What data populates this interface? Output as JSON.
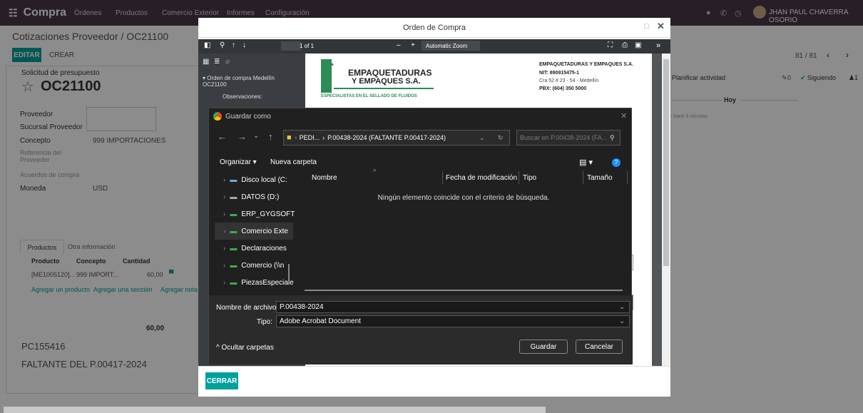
{
  "app": {
    "brand": "Compra",
    "menu": [
      "Órdenes",
      "Productos",
      "Comercio Exterior",
      "Informes",
      "Configuración"
    ],
    "user": "JHAN PAUL CHAVERRA OSORIO"
  },
  "page": {
    "breadcrumb": "Cotizaciones Proveedor / OC21100",
    "edit_label": "EDITAR",
    "create_label": "CREAR",
    "pager": "81 / 81",
    "doc_type": "Solicitud de presupuesto",
    "doc_number": "OC21100",
    "fields": [
      {
        "label": "Proveedor",
        "value": ""
      },
      {
        "label": "Sucursal Proveedor",
        "value": ""
      },
      {
        "label": "Concepto",
        "value": "999 IMPORTACIONES"
      },
      {
        "label": "Referencia del Proveedor",
        "value": ""
      },
      {
        "label": "Acuerdos de compra",
        "value": ""
      },
      {
        "label": "Moneda",
        "value": "USD"
      }
    ],
    "tabs": [
      "Productos",
      "Otra información"
    ],
    "table_headers": [
      "Producto",
      "Concepto",
      "Cantidad"
    ],
    "table_row": {
      "producto": "[ME1005120]...",
      "concepto": "999 IMPORT...",
      "cantidad": "60,00"
    },
    "add_links": [
      "Agregar un producto",
      "Agregar una sección",
      "Agregar nota"
    ],
    "total": "60,00",
    "note1": "PC155416",
    "note2": "FALTANTE DEL P.00417-2024",
    "chatter": {
      "schedule": "Planificar actividad",
      "followers": "0",
      "following": "Siguiendo",
      "members": "1",
      "today": "Hoy",
      "ago": "- hace 3 minutos"
    }
  },
  "modal": {
    "title": "Orden de Compra",
    "close_button": "CERRAR",
    "pdf": {
      "page_count": "1 of 1",
      "zoom": "Automatic Zoom",
      "outline_item": "Orden de compra Medellín OC21100",
      "outline_sub": "Observaciones:",
      "company_logo_line1": "EMPAQUETADURAS",
      "company_logo_line2": "Y EMPAQUES S.A.",
      "company_tagline": "ESPECIALISTAS EN EL SELLADO DE FLUIDOS",
      "company_name": "EMPAQUETADURAS Y EMPAQUES S.A.",
      "nit": "NIT: 890915475-1",
      "address": "Cra 52 # 23 - 54 - Medellín",
      "pbx": "PBX: (604) 350 5000"
    }
  },
  "save_dialog": {
    "title": "Guardar como",
    "path_prefix": "PEDI...",
    "path_current": "P.00438-2024 (FALTANTE P.00417-2024)",
    "search_placeholder": "Buscar en P.00438-2024 (FA...",
    "organize": "Organizar",
    "new_folder": "Nueva carpeta",
    "tree": [
      "Disco local (C:",
      "DATOS (D:)",
      "ERP_GYGSOFT",
      "Comercio Exte",
      "Declaraciones",
      "Comercio (\\\\n",
      "PiezasEspeciale"
    ],
    "columns": [
      "Nombre",
      "Fecha de modificación",
      "Tipo",
      "Tamaño"
    ],
    "empty_message": "Ningún elemento coincide con el criterio de búsqueda.",
    "filename_label": "Nombre de archivo:",
    "filename": "P.00438-2024",
    "type_label": "Tipo:",
    "type_value": "Adobe Acrobat Document",
    "hide_folders": "Ocultar carpetas",
    "save": "Guardar",
    "cancel": "Cancelar"
  }
}
